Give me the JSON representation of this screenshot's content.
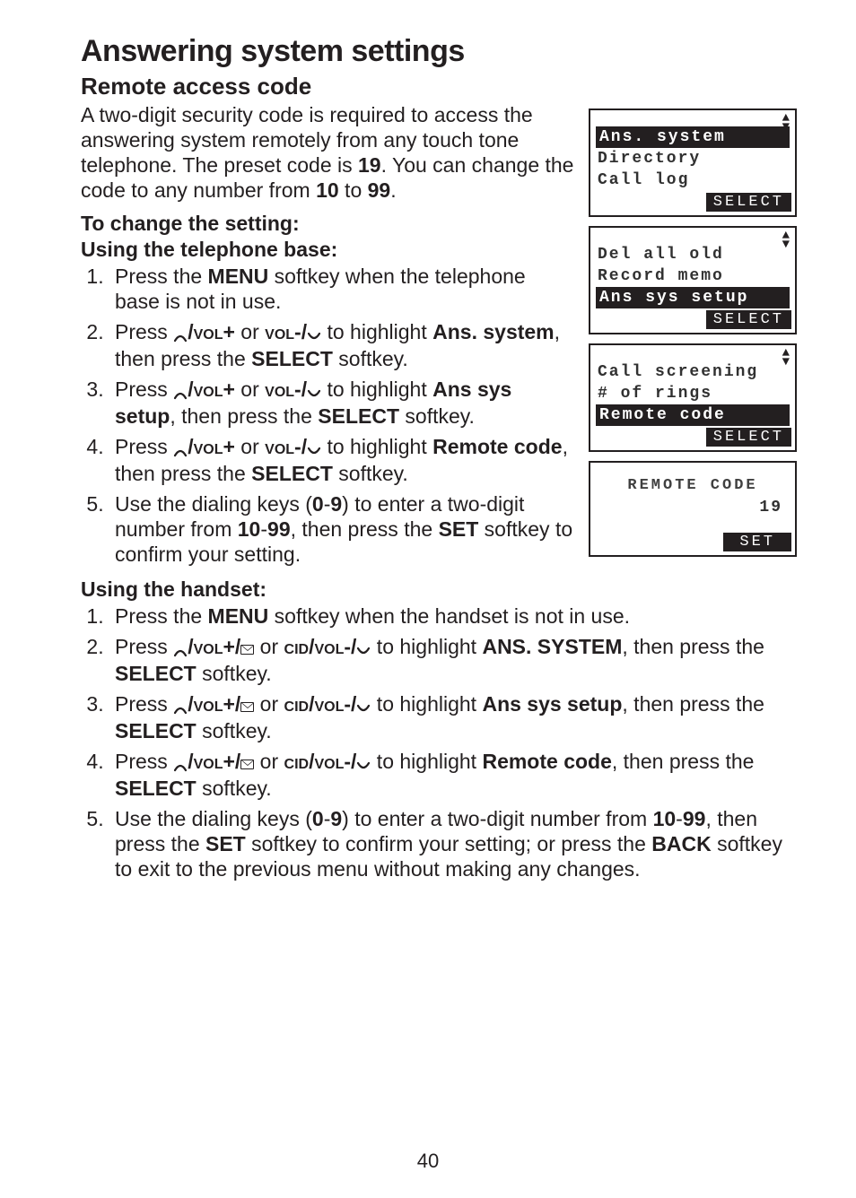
{
  "title": "Answering system settings",
  "section": "Remote access code",
  "intro_parts": {
    "p1": "A two-digit security code is required to access the answering system remotely from any touch tone telephone. The preset code is ",
    "preset": "19",
    "p2": ". You can change the code to any number from ",
    "from": "10",
    "p3": " to ",
    "to": "99",
    "p4": "."
  },
  "h_change": "To change the setting:",
  "h_base": "Using the telephone base:",
  "base_steps": {
    "s1a": "Press the ",
    "s1menu": "MENU",
    "s1b": " softkey when the telephone base is not in use.",
    "s2a": "Press ",
    "volplus": "/VOL+",
    "or": " or ",
    "volminus": "VOL-/",
    "s2b": " to highlight ",
    "ans_system": "Ans. system",
    "then_select": ", then press the ",
    "select": "SELECT",
    "softkey": " softkey.",
    "s3target": "Ans sys setup",
    "s4target": "Remote code",
    "s5a": "Use the dialing keys (",
    "range1": "0",
    "dash": "-",
    "range2": "9",
    "s5b": ") to enter a two-digit number from ",
    "from2": "10",
    "to2": "99",
    "s5c": ", then press the ",
    "set": "SET",
    "s5d": " softkey to confirm your setting."
  },
  "h_handset": "Using the handset:",
  "hs": {
    "s1a": "Press the ",
    "menu": "MENU",
    "s1b": " softkey when the handset is not in use.",
    "s2a": "Press ",
    "volplus": "/VOL+/",
    "or": " or ",
    "cidvol": "CID/VOL-/",
    "s2b": " to highlight ",
    "ans_system": "ANS. SYSTEM",
    "then": ", then press the ",
    "select": "SELECT",
    "softkey": " softkey.",
    "s3t": "Ans sys setup",
    "s4t": "Remote code",
    "s5a": "Use the dialing keys (",
    "r1": "0",
    "dash": "-",
    "r2": "9",
    "s5b": ") to enter a two-digit number from ",
    "from": "10",
    "to": "99",
    "s5c": ", then press the ",
    "set": "SET",
    "s5d": " softkey to confirm your setting; or press the ",
    "back": "BACK",
    "s5e": " softkey to exit to the previous menu without making any changes."
  },
  "screens": {
    "s1": {
      "r1": "Ans. system",
      "r2": "Directory",
      "r3": "Call log",
      "btn": "SELECT"
    },
    "s2": {
      "r1": "Del all old",
      "r2": "Record memo",
      "r3": "Ans sys setup",
      "btn": "SELECT"
    },
    "s3": {
      "r1": "Call screening",
      "r2": "# of rings",
      "r3": "Remote code",
      "btn": "SELECT"
    },
    "s4": {
      "title": "REMOTE CODE",
      "val": "19",
      "btn": "SET"
    }
  },
  "page_number": "40"
}
